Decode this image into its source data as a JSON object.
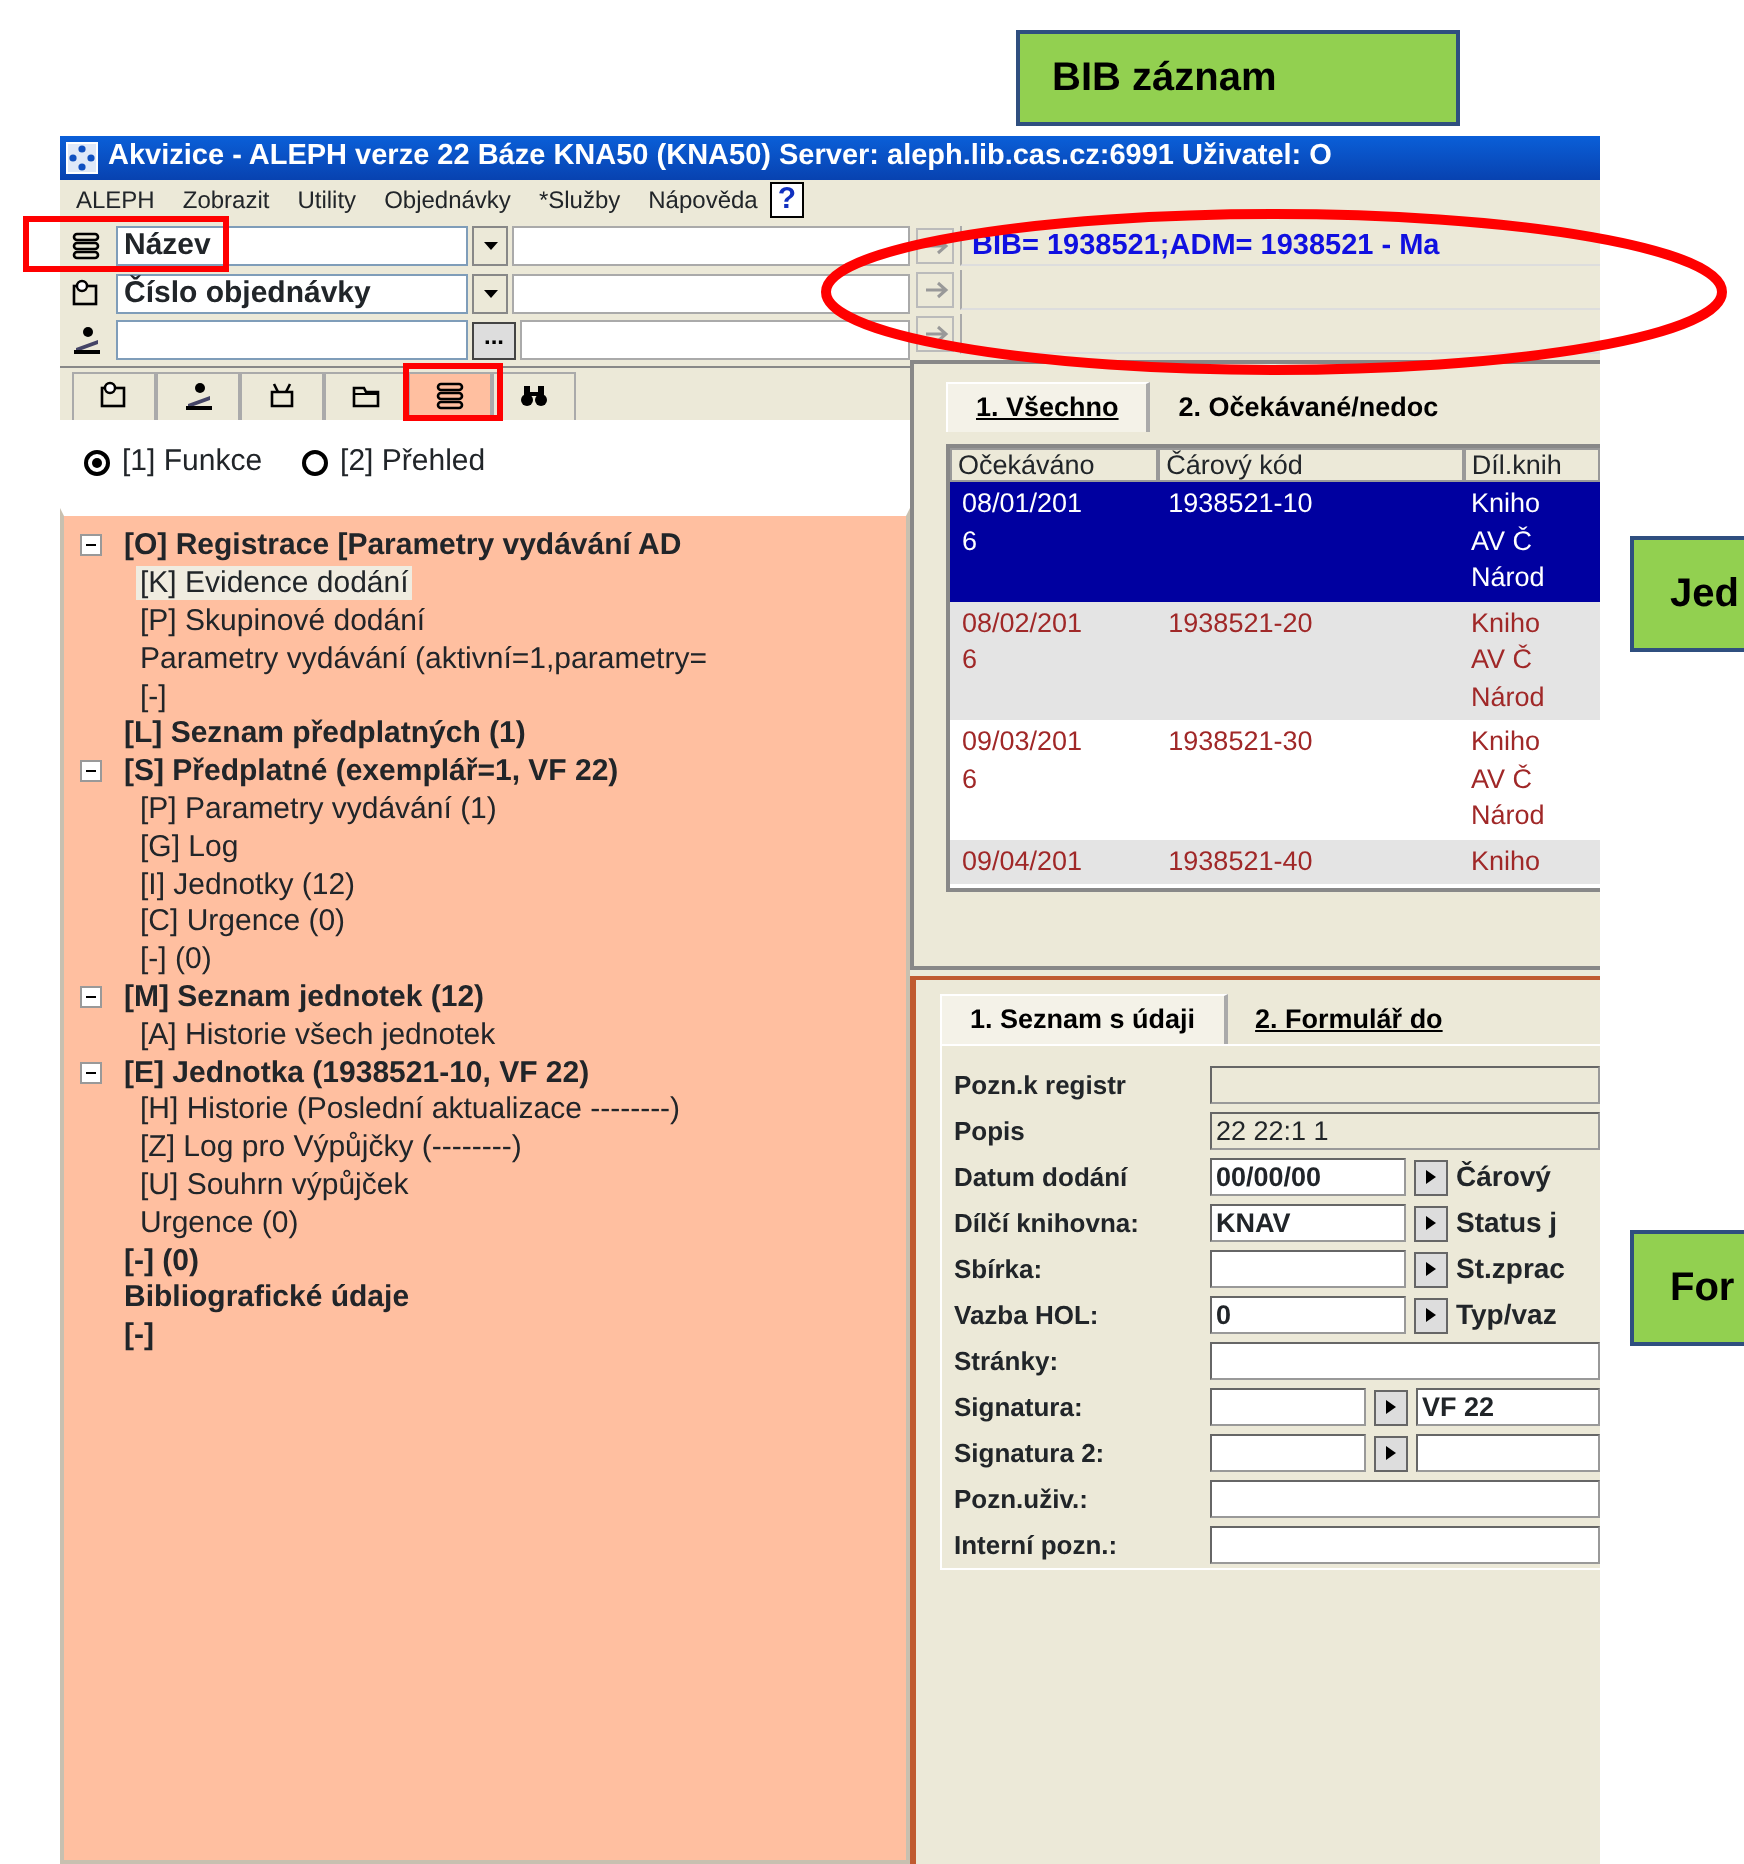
{
  "window": {
    "title": "Akvizice - ALEPH verze 22  Báze KNA50 (KNA50)  Server: aleph.lib.cas.cz:6991  Uživatel: O"
  },
  "menu": [
    "ALEPH",
    "Zobrazit",
    "Utility",
    "Objednávky",
    "*Služby",
    "Nápověda"
  ],
  "help_button": "?",
  "search_rows": [
    {
      "kind": "combo",
      "value": "Název"
    },
    {
      "kind": "combo",
      "value": "Číslo objednávky"
    },
    {
      "kind": "picker",
      "button": "..."
    }
  ],
  "record_line": "BIB= 1938521;ADM= 1938521 - Ma",
  "nav_tabs": [
    {
      "selected": false
    },
    {
      "selected": false
    },
    {
      "selected": false
    },
    {
      "selected": false
    },
    {
      "selected": true
    },
    {
      "selected": false
    }
  ],
  "view_options": [
    {
      "label": "[1] Funkce",
      "selected": true
    },
    {
      "label": "[2] Přehled",
      "selected": false
    }
  ],
  "tree": [
    {
      "label": "[O] Registrace [Parametry vydávání AD",
      "bold": true,
      "expanded": true,
      "children": [
        {
          "label": "[K] Evidence dodání",
          "selected": true
        },
        {
          "label": "[P] Skupinové dodání",
          "selected": false
        },
        {
          "label": "Parametry vydávání (aktivní=1,parametry=",
          "selected": false
        },
        {
          "label": "[-]",
          "selected": false
        }
      ]
    },
    {
      "label": "[L] Seznam předplatných (1)",
      "bold": true
    },
    {
      "label": "[S] Předplatné (exemplář=1, VF 22)",
      "bold": true,
      "expanded": true,
      "children": [
        {
          "label": "[P] Parametry vydávání (1)",
          "selected": false
        },
        {
          "label": "[G] Log",
          "selected": false
        },
        {
          "label": "[I] Jednotky (12)",
          "selected": false
        },
        {
          "label": "[C] Urgence (0)",
          "selected": false
        },
        {
          "label": "[-] (0)",
          "selected": false
        }
      ]
    },
    {
      "label": "[M] Seznam jednotek (12)",
      "bold": true,
      "expanded": true,
      "children": [
        {
          "label": "[A] Historie všech jednotek",
          "selected": false
        }
      ]
    },
    {
      "label": "[E] Jednotka (1938521-10, VF 22)",
      "bold": true,
      "expanded": true,
      "children": [
        {
          "label": "[H] Historie (Poslední aktualizace --------)",
          "selected": false
        },
        {
          "label": "[Z] Log pro Výpůjčky (--------)",
          "selected": false
        },
        {
          "label": "[U] Souhrn výpůjček",
          "selected": false
        },
        {
          "label": "Urgence (0)",
          "selected": false
        }
      ]
    },
    {
      "label": "[-] (0)",
      "bold": true
    },
    {
      "label": "Bibliografické údaje",
      "bold": true
    },
    {
      "label": "[-]",
      "bold": true
    }
  ],
  "items_panel": {
    "tabs": [
      {
        "label": "1. Všechno",
        "selected": true,
        "underlined": true
      },
      {
        "label": "2. Očekávané/nedoc",
        "selected": false,
        "underlined": false
      }
    ],
    "table": {
      "columns": [
        "Očekáváno",
        "Čárový kód",
        "Díl.knih"
      ],
      "rows": [
        {
          "selected": true,
          "cells": [
            [
              "08/01/201",
              "6"
            ],
            [
              "1938521-10"
            ],
            [
              "Kniho",
              "AV Č",
              "Národ"
            ]
          ]
        },
        {
          "selected": false,
          "cells": [
            [
              "08/02/201",
              "6"
            ],
            [
              "1938521-20"
            ],
            [
              "Kniho",
              "AV Č",
              "Národ"
            ]
          ]
        },
        {
          "selected": false,
          "cells": [
            [
              "09/03/201",
              "6"
            ],
            [
              "1938521-30"
            ],
            [
              "Kniho",
              "AV Č",
              "Národ"
            ]
          ]
        },
        {
          "selected": false,
          "cells": [
            [
              "09/04/201"
            ],
            [
              "1938521-40"
            ],
            [
              "Kniho"
            ]
          ]
        }
      ]
    }
  },
  "form_panel": {
    "tabs": [
      {
        "label": "1. Seznam s údaji",
        "selected": true,
        "underlined": false
      },
      {
        "label": "2. Formulář do",
        "selected": false,
        "underlined": true
      }
    ],
    "fields": [
      {
        "kind": "wide",
        "label": "Pozn.k registr",
        "readonly": true
      },
      {
        "kind": "wide",
        "label": "Popis",
        "value": "22 22:1 1",
        "readonly": true
      },
      {
        "kind": "select",
        "label": "Datum dodání",
        "value": "00/00/00",
        "side_label": "Čárový"
      },
      {
        "kind": "select",
        "label": "Dílčí knihovna:",
        "value": "KNAV",
        "side_label": "Status j"
      },
      {
        "kind": "select",
        "label": "Sbírka:",
        "side_label": "St.zprac"
      },
      {
        "kind": "select",
        "label": "Vazba HOL:",
        "value": "0",
        "side_label": "Typ/vaz"
      },
      {
        "kind": "wide",
        "label": "Stránky:",
        "readonly": false
      },
      {
        "kind": "double",
        "label": "Signatura:",
        "value2": "VF 22"
      },
      {
        "kind": "double",
        "label": "Signatura 2:"
      },
      {
        "kind": "wide",
        "label": "Pozn.uživ.:",
        "readonly": false
      },
      {
        "kind": "wide",
        "label": "Interní pozn.:",
        "readonly": false
      }
    ]
  },
  "top_callout": "BIB záznam",
  "side_callouts": [
    "Jed",
    "For"
  ]
}
